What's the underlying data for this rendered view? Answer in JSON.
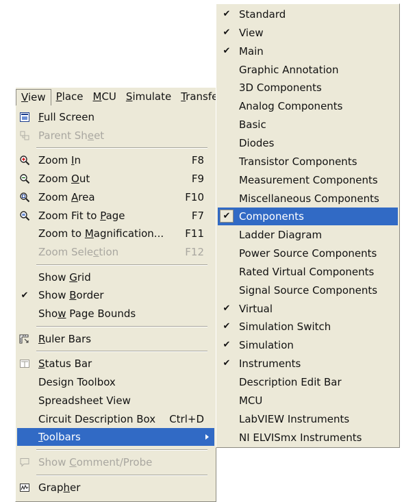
{
  "menubar": {
    "items": [
      {
        "label": "View",
        "u": "V"
      },
      {
        "label": "Place",
        "u": "P"
      },
      {
        "label": "MCU",
        "u": "M"
      },
      {
        "label": "Simulate",
        "u": "S"
      },
      {
        "label": "Transfer",
        "u": "T"
      }
    ]
  },
  "view_menu": {
    "items": [
      {
        "type": "item",
        "pre": "",
        "u": "F",
        "post": "ull Screen",
        "shortcut": "",
        "icon": "fullscreen-icon",
        "disabled": false
      },
      {
        "type": "item",
        "pre": "Parent Sh",
        "u": "e",
        "post": "et",
        "shortcut": "",
        "icon": "parent-sheet-icon",
        "disabled": true
      },
      {
        "type": "sep"
      },
      {
        "type": "item",
        "pre": "Zoom ",
        "u": "I",
        "post": "n",
        "shortcut": "F8",
        "icon": "zoom-in-icon",
        "disabled": false
      },
      {
        "type": "item",
        "pre": "Zoom ",
        "u": "O",
        "post": "ut",
        "shortcut": "F9",
        "icon": "zoom-out-icon",
        "disabled": false
      },
      {
        "type": "item",
        "pre": "Zoom ",
        "u": "A",
        "post": "rea",
        "shortcut": "F10",
        "icon": "zoom-area-icon",
        "disabled": false
      },
      {
        "type": "item",
        "pre": "Zoom Fit to ",
        "u": "P",
        "post": "age",
        "shortcut": "F7",
        "icon": "zoom-fit-icon",
        "disabled": false
      },
      {
        "type": "item",
        "pre": "Zoom to ",
        "u": "M",
        "post": "agnification...",
        "shortcut": "F11",
        "icon": "",
        "disabled": false
      },
      {
        "type": "item",
        "pre": "Zoom Sele",
        "u": "c",
        "post": "tion",
        "shortcut": "F12",
        "icon": "",
        "disabled": true
      },
      {
        "type": "sep"
      },
      {
        "type": "item",
        "pre": "Show ",
        "u": "G",
        "post": "rid",
        "shortcut": "",
        "icon": "",
        "disabled": false
      },
      {
        "type": "item",
        "pre": "Show ",
        "u": "B",
        "post": "order",
        "shortcut": "",
        "icon": "check-icon",
        "disabled": false
      },
      {
        "type": "item",
        "pre": "Sho",
        "u": "w",
        "post": " Page Bounds",
        "shortcut": "",
        "icon": "",
        "disabled": false
      },
      {
        "type": "sep"
      },
      {
        "type": "item",
        "pre": "",
        "u": "R",
        "post": "uler Bars",
        "shortcut": "",
        "icon": "ruler-icon",
        "disabled": false
      },
      {
        "type": "sep"
      },
      {
        "type": "item",
        "pre": "",
        "u": "S",
        "post": "tatus Bar",
        "shortcut": "",
        "icon": "status-bar-icon",
        "disabled": false
      },
      {
        "type": "item",
        "pre": "Design Toolbox",
        "u": "",
        "post": "",
        "shortcut": "",
        "icon": "",
        "disabled": false
      },
      {
        "type": "item",
        "pre": "Spreadsheet View",
        "u": "",
        "post": "",
        "shortcut": "",
        "icon": "",
        "disabled": false
      },
      {
        "type": "item",
        "pre": "Circuit Description Box",
        "u": "",
        "post": "",
        "shortcut": "Ctrl+D",
        "icon": "",
        "disabled": false
      },
      {
        "type": "item",
        "pre": "",
        "u": "T",
        "post": "oolbars",
        "shortcut": "",
        "icon": "",
        "disabled": false,
        "highlight": true,
        "submenu": true
      },
      {
        "type": "sep"
      },
      {
        "type": "item",
        "pre": "Show ",
        "u": "C",
        "post": "omment/Probe",
        "shortcut": "",
        "icon": "comment-icon",
        "disabled": true
      },
      {
        "type": "sep"
      },
      {
        "type": "item",
        "pre": "Grap",
        "u": "h",
        "post": "er",
        "shortcut": "",
        "icon": "grapher-icon",
        "disabled": false
      }
    ]
  },
  "toolbars_menu": {
    "items": [
      {
        "label": "Standard",
        "checked": true
      },
      {
        "label": "View",
        "checked": true
      },
      {
        "label": "Main",
        "checked": true
      },
      {
        "label": "Graphic Annotation",
        "checked": false
      },
      {
        "label": "3D Components",
        "checked": false
      },
      {
        "label": "Analog Components",
        "checked": false
      },
      {
        "label": "Basic",
        "checked": false
      },
      {
        "label": "Diodes",
        "checked": false
      },
      {
        "label": "Transistor Components",
        "checked": false
      },
      {
        "label": "Measurement Components",
        "checked": false
      },
      {
        "label": "Miscellaneous Components",
        "checked": false
      },
      {
        "label": "Components",
        "checked": true,
        "highlight": true
      },
      {
        "label": "Ladder Diagram",
        "checked": false
      },
      {
        "label": "Power Source Components",
        "checked": false
      },
      {
        "label": "Rated Virtual Components",
        "checked": false
      },
      {
        "label": "Signal Source Components",
        "checked": false
      },
      {
        "label": "Virtual",
        "checked": true
      },
      {
        "label": "Simulation Switch",
        "checked": true
      },
      {
        "label": "Simulation",
        "checked": true
      },
      {
        "label": "Instruments",
        "checked": true
      },
      {
        "label": "Description Edit Bar",
        "checked": false
      },
      {
        "label": "MCU",
        "checked": false
      },
      {
        "label": "LabVIEW Instruments",
        "checked": false
      },
      {
        "label": "NI ELVISmx Instruments",
        "checked": false
      }
    ]
  }
}
